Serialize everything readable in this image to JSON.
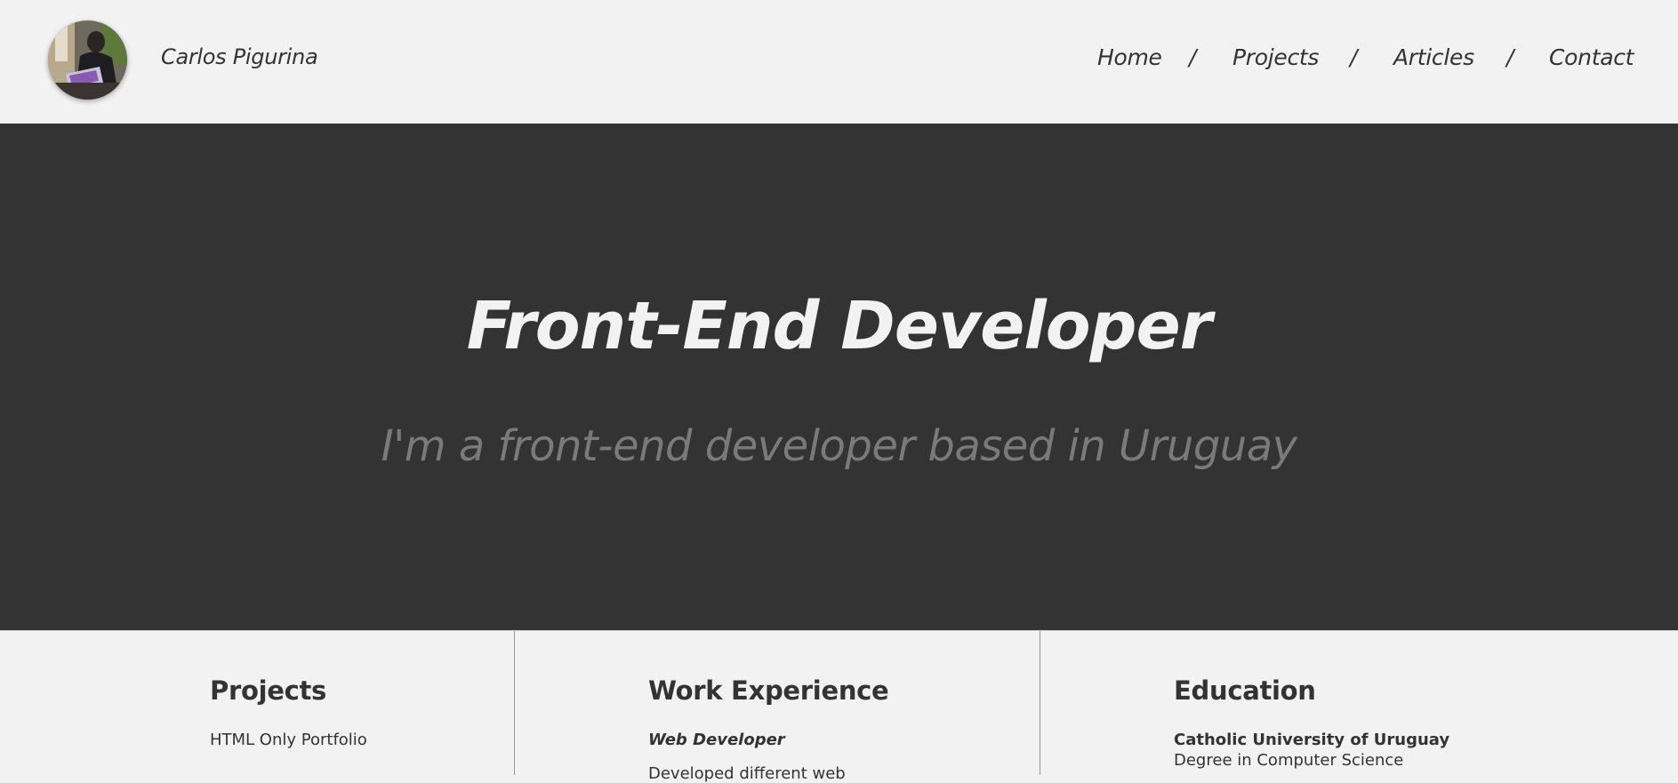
{
  "header": {
    "site_name": "Carlos Pigurina",
    "avatar_alt": "profile-photo"
  },
  "nav": {
    "items": [
      {
        "label": "Home"
      },
      {
        "label": "Projects"
      },
      {
        "label": "Articles"
      },
      {
        "label": "Contact"
      }
    ],
    "separator": "/"
  },
  "hero": {
    "title": "Front-End Developer",
    "subtitle": "I'm a front-end developer based in Uruguay"
  },
  "sections": {
    "projects": {
      "heading": "Projects",
      "items": [
        "HTML Only Portfolio"
      ]
    },
    "work": {
      "heading": "Work Experience",
      "role": "Web Developer",
      "description": "Developed different web"
    },
    "education": {
      "heading": "Education",
      "school": "Catholic University of Uruguay",
      "degree": "Degree in Computer Science"
    }
  },
  "colors": {
    "page_background": "#f2f2f2",
    "hero_background": "#333333",
    "hero_title": "#f2f2f2",
    "hero_subtitle": "#7a7a7a",
    "text": "#333333"
  }
}
